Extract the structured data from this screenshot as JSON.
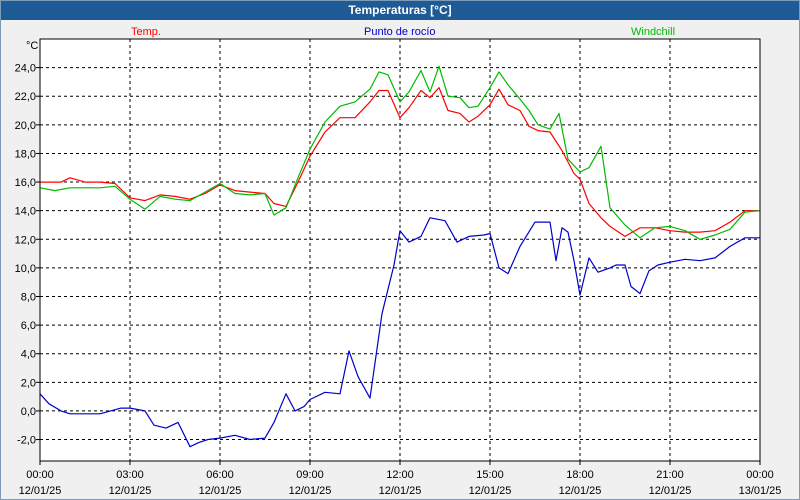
{
  "window": {
    "title": "Temperaturas [°C]"
  },
  "colors": {
    "titlebar": "#1e5b96",
    "temp": "#ff0000",
    "dew": "#0000cc",
    "windchill": "#00bb00",
    "grid": "#000000"
  },
  "chart_data": {
    "type": "line",
    "title": "Temperaturas [°C]",
    "ylabel": "°C",
    "xlabel": "",
    "ylim": [
      -3.5,
      26.0
    ],
    "y_ticks": [
      24.0,
      22.0,
      20.0,
      18.0,
      16.0,
      14.0,
      12.0,
      10.0,
      8.0,
      6.0,
      4.0,
      2.0,
      0.0,
      -2.0
    ],
    "y_tick_labels": [
      "24,0",
      "22,0",
      "20,0",
      "18,0",
      "16,0",
      "14,0",
      "12,0",
      "10,0",
      "8,0",
      "6,0",
      "4,0",
      "2,0",
      "0,0",
      "-2,0"
    ],
    "x_range_hours": [
      0,
      24
    ],
    "x_ticks": [
      0,
      3,
      6,
      9,
      12,
      15,
      18,
      21,
      24
    ],
    "x_tick_labels": [
      [
        "00:00",
        "12/01/25"
      ],
      [
        "03:00",
        "12/01/25"
      ],
      [
        "06:00",
        "12/01/25"
      ],
      [
        "09:00",
        "12/01/25"
      ],
      [
        "12:00",
        "12/01/25"
      ],
      [
        "15:00",
        "12/01/25"
      ],
      [
        "18:00",
        "12/01/25"
      ],
      [
        "21:00",
        "12/01/25"
      ],
      [
        "00:00",
        "13/01/25"
      ]
    ],
    "grid": true,
    "legend_placement": "top",
    "series": [
      {
        "name": "Temp.",
        "color": "#ff0000",
        "x": [
          0,
          0.7,
          1.0,
          1.5,
          2.0,
          2.5,
          3.0,
          3.5,
          4.0,
          4.5,
          5.0,
          5.5,
          6.0,
          6.5,
          7.0,
          7.5,
          7.8,
          8.2,
          8.6,
          9.0,
          9.5,
          10.0,
          10.5,
          11.0,
          11.3,
          11.6,
          12.0,
          12.3,
          12.7,
          13.0,
          13.3,
          13.6,
          14.0,
          14.3,
          14.6,
          15.0,
          15.3,
          15.6,
          16.0,
          16.3,
          16.6,
          17.0,
          17.4,
          17.8,
          18.0,
          18.3,
          18.7,
          19.0,
          19.5,
          20.0,
          20.5,
          21.0,
          21.5,
          22.0,
          22.5,
          23.0,
          23.5,
          24.0
        ],
        "y": [
          16.0,
          16.0,
          16.3,
          16.0,
          16.0,
          15.9,
          14.9,
          14.7,
          15.1,
          15.0,
          14.8,
          15.2,
          15.8,
          15.4,
          15.3,
          15.2,
          14.5,
          14.3,
          16.0,
          17.8,
          19.5,
          20.5,
          20.5,
          21.6,
          22.4,
          22.4,
          20.5,
          21.2,
          22.4,
          21.9,
          22.6,
          21.0,
          20.8,
          20.2,
          20.6,
          21.4,
          22.5,
          21.4,
          21.0,
          19.9,
          19.6,
          19.5,
          18.2,
          16.6,
          16.2,
          14.5,
          13.5,
          12.9,
          12.2,
          12.8,
          12.8,
          12.6,
          12.5,
          12.5,
          12.6,
          13.2,
          14.0,
          14.0
        ]
      },
      {
        "name": "Punto de rocío",
        "color": "#0000cc",
        "x": [
          0,
          0.3,
          0.7,
          1.0,
          2.0,
          2.7,
          3.0,
          3.5,
          3.8,
          4.2,
          4.6,
          5.0,
          5.3,
          5.6,
          6.0,
          6.5,
          7.0,
          7.5,
          7.8,
          8.2,
          8.5,
          8.8,
          9.0,
          9.5,
          10.0,
          10.3,
          10.6,
          11.0,
          11.4,
          11.8,
          12.0,
          12.3,
          12.7,
          13.0,
          13.5,
          13.9,
          14.3,
          14.8,
          15.0,
          15.3,
          15.6,
          16.0,
          16.5,
          17.0,
          17.2,
          17.4,
          17.6,
          17.8,
          18.0,
          18.3,
          18.6,
          19.0,
          19.2,
          19.5,
          19.7,
          20.0,
          20.3,
          20.6,
          21.0,
          21.5,
          22.0,
          22.5,
          23.0,
          23.5,
          24.0
        ],
        "y": [
          1.2,
          0.5,
          0.0,
          -0.2,
          -0.2,
          0.2,
          0.2,
          0.0,
          -1.0,
          -1.2,
          -0.8,
          -2.5,
          -2.2,
          -2.0,
          -1.9,
          -1.7,
          -2.0,
          -1.9,
          -0.8,
          1.2,
          0.0,
          0.3,
          0.8,
          1.3,
          1.2,
          4.2,
          2.4,
          0.9,
          6.8,
          10.2,
          12.6,
          11.8,
          12.2,
          13.5,
          13.3,
          11.8,
          12.2,
          12.3,
          12.4,
          10.0,
          9.6,
          11.5,
          13.2,
          13.2,
          10.5,
          12.8,
          12.5,
          10.5,
          8.1,
          10.7,
          9.7,
          10.0,
          10.2,
          10.2,
          8.7,
          8.2,
          9.8,
          10.2,
          10.4,
          10.6,
          10.5,
          10.7,
          11.5,
          12.1,
          12.1
        ]
      },
      {
        "name": "Windchill",
        "color": "#00bb00",
        "x": [
          0,
          0.5,
          1.0,
          1.5,
          2.0,
          2.5,
          3.0,
          3.5,
          4.0,
          4.5,
          5.0,
          5.5,
          6.0,
          6.5,
          7.0,
          7.5,
          7.8,
          8.2,
          8.6,
          9.0,
          9.5,
          10.0,
          10.5,
          11.0,
          11.3,
          11.6,
          12.0,
          12.3,
          12.7,
          13.0,
          13.3,
          13.6,
          14.0,
          14.3,
          14.6,
          15.0,
          15.3,
          15.6,
          16.0,
          16.3,
          16.6,
          17.0,
          17.3,
          17.6,
          18.0,
          18.3,
          18.7,
          19.0,
          19.5,
          20.0,
          20.5,
          21.0,
          21.5,
          22.0,
          22.5,
          23.0,
          23.5,
          24.0
        ],
        "y": [
          15.6,
          15.4,
          15.6,
          15.6,
          15.6,
          15.7,
          14.8,
          14.1,
          15.0,
          14.8,
          14.7,
          15.3,
          15.9,
          15.2,
          15.1,
          15.2,
          13.7,
          14.2,
          16.3,
          18.3,
          20.2,
          21.3,
          21.6,
          22.5,
          23.7,
          23.5,
          21.6,
          22.3,
          23.8,
          22.3,
          24.1,
          22.0,
          21.9,
          21.2,
          21.3,
          22.6,
          23.7,
          22.8,
          21.8,
          21.0,
          20.0,
          19.7,
          20.8,
          17.6,
          16.7,
          17.0,
          18.5,
          14.2,
          13.0,
          12.1,
          12.8,
          12.9,
          12.6,
          12.0,
          12.3,
          12.7,
          13.9,
          14.0
        ]
      }
    ]
  }
}
